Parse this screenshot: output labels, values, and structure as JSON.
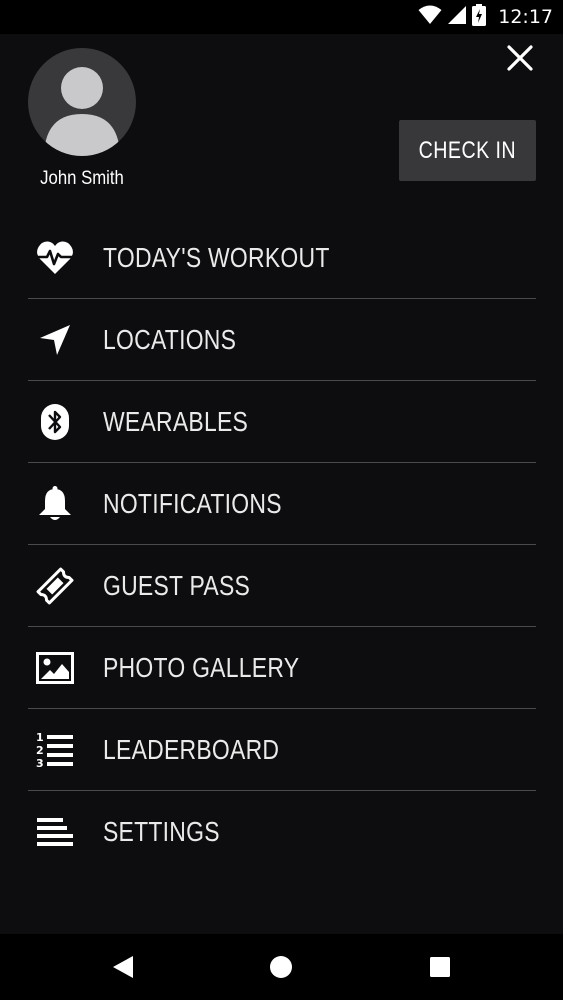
{
  "status_bar": {
    "time": "12:17",
    "icons": [
      "wifi-icon",
      "signal-icon",
      "battery-charging-icon"
    ]
  },
  "user": {
    "name": "John Smith",
    "avatar_icon": "person-icon"
  },
  "actions": {
    "close_icon": "close-icon",
    "check_in_label": "CHECK IN"
  },
  "menu": {
    "items": [
      {
        "label": "TODAY'S WORKOUT",
        "icon": "heart-pulse-icon"
      },
      {
        "label": "LOCATIONS",
        "icon": "navigation-arrow-icon"
      },
      {
        "label": "WEARABLES",
        "icon": "bluetooth-icon"
      },
      {
        "label": "NOTIFICATIONS",
        "icon": "bell-icon"
      },
      {
        "label": "GUEST PASS",
        "icon": "ticket-icon"
      },
      {
        "label": "PHOTO GALLERY",
        "icon": "image-icon"
      },
      {
        "label": "LEADERBOARD",
        "icon": "numbered-list-icon"
      },
      {
        "label": "SETTINGS",
        "icon": "align-left-icon"
      }
    ]
  },
  "nav_bar": {
    "buttons": [
      "back-icon",
      "home-icon",
      "recents-icon"
    ]
  },
  "colors": {
    "drawer_background": "#0d0c0e",
    "button_background": "#38373a",
    "divider": "#4a494c",
    "avatar_background": "#39383b",
    "text": "#ffffff"
  }
}
